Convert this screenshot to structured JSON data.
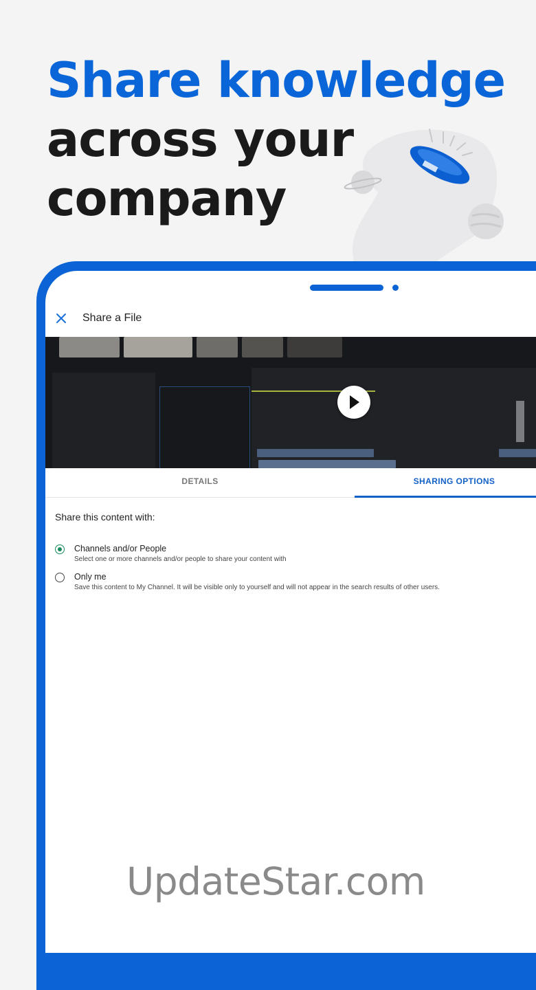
{
  "headline": {
    "line1": "Share knowledge",
    "line2": "across your",
    "line3": "company"
  },
  "colors": {
    "accent": "#0a66d8",
    "device_frame": "#0b63d6",
    "radio_checked": "#168a5a",
    "tab_active": "#1260c8"
  },
  "app": {
    "close_icon": "close-icon",
    "title": "Share a File"
  },
  "video": {
    "play_icon": "play-icon"
  },
  "tabs": [
    {
      "label": "DETAILS",
      "active": false
    },
    {
      "label": "SHARING OPTIONS",
      "active": true
    }
  ],
  "share": {
    "heading": "Share this content with:",
    "options": [
      {
        "title": "Channels and/or People",
        "description": "Select one or more channels and/or people to share your content with",
        "selected": true
      },
      {
        "title": "Only me",
        "description": "Save this content to My Channel. It will be visible only to yourself and will not appear in the search results of other users.",
        "selected": false
      }
    ]
  },
  "watermark": "UpdateStar.com"
}
